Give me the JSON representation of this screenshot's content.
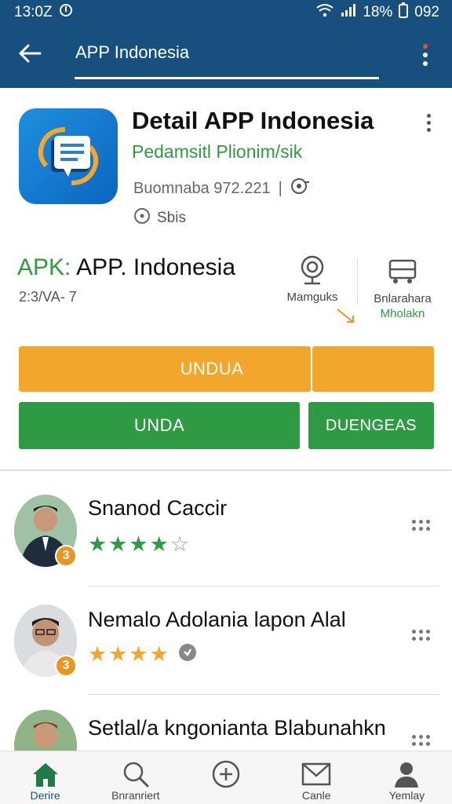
{
  "status_bar": {
    "time": "13:0Z",
    "battery_text": "18%",
    "extra": "092"
  },
  "app_bar": {
    "title": "APP Indonesia",
    "back_icon": "back-arrow-icon",
    "menu_icon": "more-vert-icon"
  },
  "app": {
    "title": "Detail APP Indonesia",
    "developer": "Pedamsitl Plionim/sik",
    "meta": "Buomnaba 972.221",
    "size": "Sbis"
  },
  "apk": {
    "prefix": "APK:",
    "name": "APP. Indonesia",
    "sub": "2:3/VA- 7"
  },
  "stats": {
    "stat1_label": "Mamguks",
    "stat2_label": "Bnlarahara",
    "stat2_sub": "Mholakn"
  },
  "buttons": {
    "orange_main": "UNDUA",
    "green_main": "UNDA",
    "green_side": "DUENGEAS"
  },
  "reviews": [
    {
      "name": "Snanod Caccir",
      "badge": "3",
      "rating": 4,
      "star_color": "#2e9b44"
    },
    {
      "name": "Nemalo Adolania lapon Alal",
      "badge": "3",
      "rating": 4,
      "star_color": "#f2a72c"
    },
    {
      "name": "Setlal/a kngonianta Blabunahkn",
      "badge": "",
      "rating": 0,
      "star_color": "#2e9b44"
    }
  ],
  "bottom_nav": [
    {
      "label": "Derire",
      "icon": "home-icon"
    },
    {
      "label": "Bnranriert",
      "icon": "search-icon"
    },
    {
      "label": "",
      "icon": "add-circle-icon"
    },
    {
      "label": "Canle",
      "icon": "mail-icon"
    },
    {
      "label": "Yemlay",
      "icon": "profile-icon"
    }
  ],
  "colors": {
    "primary": "#17507f",
    "green": "#2e9b44",
    "orange": "#f2a72c"
  }
}
